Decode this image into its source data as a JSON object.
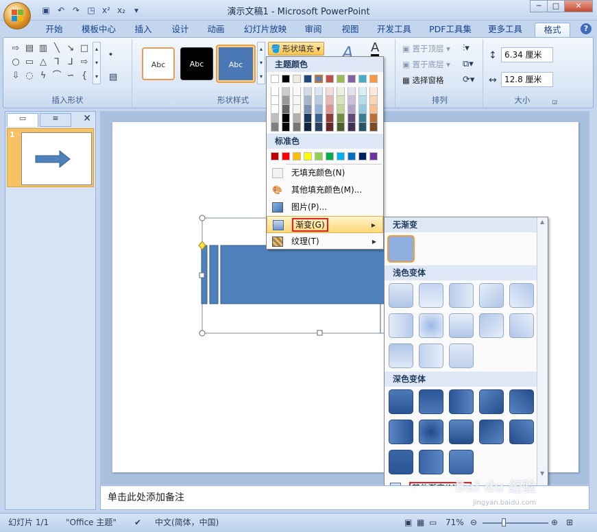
{
  "window": {
    "title": "演示文稿1 - Microsoft PowerPoint",
    "controls": {
      "minimize": "─",
      "maximize": "□",
      "close": "✕"
    }
  },
  "tabs": [
    "开始",
    "模板中心",
    "插入",
    "设计",
    "动画",
    "幻灯片放映",
    "审阅",
    "视图",
    "开发工具",
    "PDF工具集",
    "更多工具",
    "格式"
  ],
  "ribbon": {
    "groups": {
      "insert_shapes": "插入形状",
      "shape_styles": "形状样式",
      "arrange": "排列",
      "size": "大小"
    },
    "style_sample": "Abc",
    "shape_fill": "形状填充",
    "arrange": {
      "bring_front": "置于顶层",
      "send_back": "置于底层",
      "selection_pane": "选择窗格"
    },
    "size": {
      "height": "6.34 厘米",
      "width": "12.8 厘米"
    }
  },
  "fill_menu": {
    "theme_header": "主题颜色",
    "standard_header": "标准色",
    "theme_colors": [
      "#ffffff",
      "#000000",
      "#eeece1",
      "#1f497d",
      "#4f81bd",
      "#c0504d",
      "#9bbb59",
      "#8064a2",
      "#4bacc6",
      "#f79646"
    ],
    "standard_colors": [
      "#c00000",
      "#ff0000",
      "#ffc000",
      "#ffff00",
      "#92d050",
      "#00b050",
      "#00b0f0",
      "#0070c0",
      "#002060",
      "#7030a0"
    ],
    "items": {
      "no_fill": "无填充颜色(N)",
      "more_colors": "其他填充颜色(M)...",
      "picture": "图片(P)...",
      "gradient": "渐变(G)",
      "texture": "纹理(T)"
    }
  },
  "gradient_menu": {
    "no_gradient": "无渐变",
    "light": "浅色变体",
    "dark": "深色变体",
    "more": "其他渐变(M)..."
  },
  "left_panel": {
    "slide_number": "1"
  },
  "notes": {
    "placeholder": "单击此处添加备注"
  },
  "status": {
    "slide": "幻灯片 1/1",
    "theme": "\"Office 主题\"",
    "language": "中文(简体，中国)",
    "zoom": "71%"
  },
  "watermark": {
    "brand": "Bai du 经验",
    "url": "jingyan.baidu.com"
  }
}
